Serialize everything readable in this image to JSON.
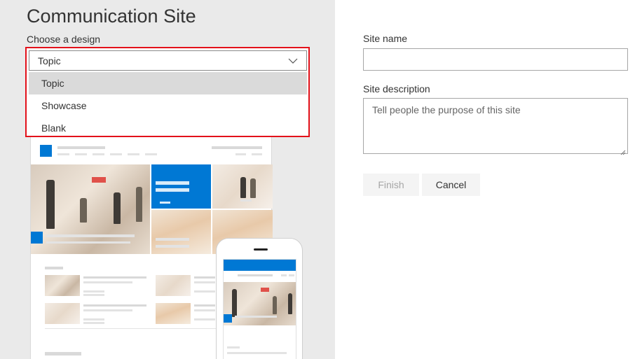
{
  "header": {
    "title": "Communication Site",
    "design_label": "Choose a design"
  },
  "design_select": {
    "value": "Topic",
    "options": [
      "Topic",
      "Showcase",
      "Blank"
    ],
    "selected_index": 0
  },
  "form": {
    "site_name_label": "Site name",
    "site_name_value": "",
    "site_description_label": "Site description",
    "site_description_placeholder": "Tell people the purpose of this site"
  },
  "buttons": {
    "finish": "Finish",
    "cancel": "Cancel"
  },
  "colors": {
    "accent": "#0078d4",
    "highlight_border": "#e3111a",
    "left_panel_bg": "#eaeaea",
    "selected_option_bg": "#dadada"
  },
  "icons": {
    "dropdown": "chevron-down-icon"
  }
}
